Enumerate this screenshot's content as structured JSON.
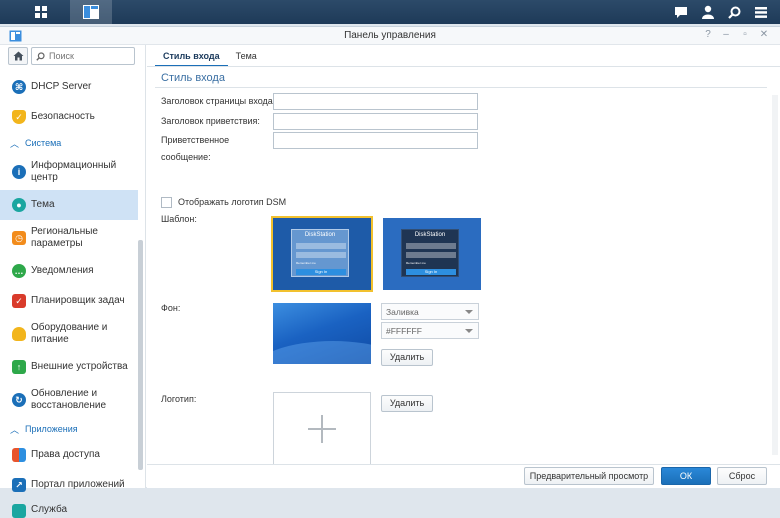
{
  "taskbar": {
    "icons": [
      "apps-grid-icon",
      "control-panel-window-icon",
      "notifications-icon",
      "user-icon",
      "search-icon",
      "widgets-icon"
    ]
  },
  "window": {
    "title": "Панель управления",
    "controls": [
      "?",
      "–",
      "▫",
      "✕"
    ]
  },
  "sidebar": {
    "search_placeholder": "Поиск",
    "items": [
      {
        "label": "DHCP Server",
        "color": "#1b6fb8"
      },
      {
        "label": "Безопасность",
        "color": "#f2b51c"
      },
      {
        "section": "Система"
      },
      {
        "label": "Информационный центр",
        "color": "#1b6fb8"
      },
      {
        "label": "Тема",
        "color": "#1aa6a0",
        "active": true
      },
      {
        "label": "Региональные параметры",
        "color": "#f28c1c"
      },
      {
        "label": "Уведомления",
        "color": "#2ea84a"
      },
      {
        "label": "Планировщик задач",
        "color": "#d93b2b"
      },
      {
        "label": "Оборудование и питание",
        "color": "#f2b51c"
      },
      {
        "label": "Внешние устройства",
        "color": "#2ea84a"
      },
      {
        "label": "Обновление и восстановление",
        "color": "#1b6fb8"
      },
      {
        "section": "Приложения"
      },
      {
        "label": "Права доступа",
        "color": "#e8542c"
      },
      {
        "label": "Портал приложений",
        "color": "#1b6fb8"
      },
      {
        "label": "Служба",
        "color": "#1aa6a0"
      }
    ]
  },
  "tabs": [
    "Стиль входа",
    "Тема"
  ],
  "content": {
    "section_title": "Стиль входа",
    "login_page_title_label": "Заголовок страницы входа:",
    "welcome_title_label": "Заголовок приветствия:",
    "welcome_message_label_1": "Приветственное",
    "welcome_message_label_2": "сообщение:",
    "show_logo_label": "Отображать логотип DSM",
    "template_label": "Шаблон:",
    "template_name": "DiskStation",
    "template_button": "Sign In",
    "template_remember": "Remember me",
    "background_label": "Фон:",
    "fill_select": "Заливка",
    "color_select": "#FFFFFF",
    "delete_label": "Удалить",
    "logo_label": "Логотип:"
  },
  "footer": {
    "preview": "Предварительный просмотр",
    "ok": "ОК",
    "reset": "Сброс"
  },
  "colors": {
    "accent": "#1b6fb8",
    "selected_template_border": "#f2c12e",
    "active_sidebar": "#cfe2f5"
  }
}
